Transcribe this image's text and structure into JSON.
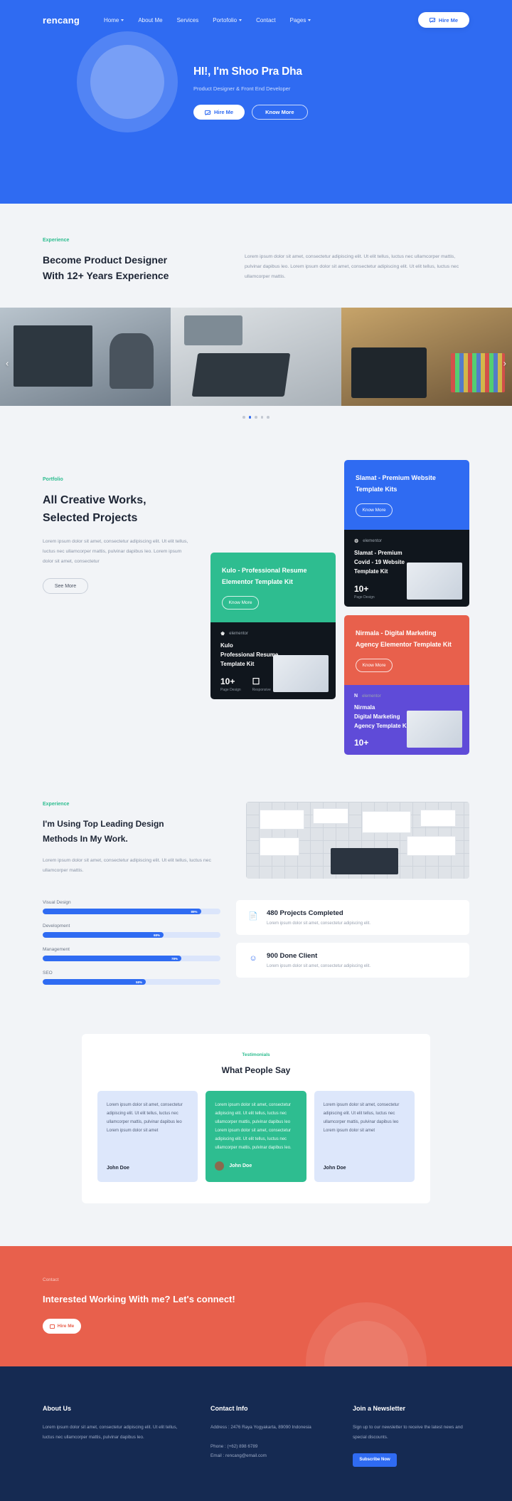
{
  "nav": {
    "logo": "rencang",
    "links": [
      {
        "label": "Home",
        "caret": true
      },
      {
        "label": "About Me",
        "caret": false
      },
      {
        "label": "Services",
        "caret": false
      },
      {
        "label": "Portofolio",
        "caret": true
      },
      {
        "label": "Contact",
        "caret": false
      },
      {
        "label": "Pages",
        "caret": true
      }
    ],
    "cta": "Hire Me"
  },
  "hero": {
    "title": "HI!, I'm Shoo Pra Dha",
    "subtitle": "Product Designer & Front End Developer",
    "btn_primary": "Hire Me",
    "btn_secondary": "Know More"
  },
  "experience": {
    "eyebrow": "Experience",
    "heading_line1": "Become Product Designer",
    "heading_line2": "With 12+ Years Experience",
    "paragraph": "Lorem ipsum dolor sit amet, consectetur adipiscing elit. Ut elit tellus, luctus nec ullamcorper mattis, pulvinar dapibus leo. Lorem ipsum dolor sit amet, consectetur adipiscing elit. Ut elit tellus, luctus nec ullamcorper mattis."
  },
  "slider": {
    "prev": "‹",
    "next": "›",
    "dots": 5,
    "active_dot": 1
  },
  "portfolio": {
    "eyebrow": "Portfolio",
    "heading_line1": "All Creative Works,",
    "heading_line2": "Selected Projects",
    "paragraph": "Lorem ipsum dolor sit amet, consectetur adipiscing elit. Ut elit tellus, luctus nec ullamcorper mattis, pulvinar dapibus leo. Lorem ipsum dolor sit amet, consectetur",
    "see_more": "See More",
    "cards": [
      {
        "title_line1": "Slamat - Premium Website",
        "title_line2": "Template Kits",
        "button": "Know More",
        "color": "#2f6bf2",
        "shot_title_line1": "Slamat - Premium",
        "shot_title_line2": "Covid - 19 Website",
        "shot_title_line3": "Template Kit",
        "shot_brand": "elementor",
        "stat1_num": "10+",
        "stat1_cap": "Page Design",
        "stat2_num": "",
        "stat2_cap": ""
      },
      {
        "title_line1": "Kulo - Professional Resume",
        "title_line2": "Elementor Template Kit",
        "button": "Know More",
        "color": "#2ebd90",
        "shot_title_line1": "Kulo",
        "shot_title_line2": "Professional Resume",
        "shot_title_line3": "Template Kit",
        "shot_brand": "elementor",
        "stat1_num": "10+",
        "stat1_cap": "Page Design",
        "stat2_num": "",
        "stat2_cap": "Responsive"
      },
      {
        "title_line1": "Nirmala - Digital Marketing",
        "title_line2": "Agency Elementor Template Kit",
        "button": "Know More",
        "color": "#e8604c",
        "shot_title_line1": "Nirmala",
        "shot_title_line2": "Digital Marketing",
        "shot_title_line3": "Agency Template Kit",
        "shot_brand": "elementor",
        "stat1_num": "10+",
        "stat1_cap": "",
        "stat2_num": "",
        "stat2_cap": ""
      }
    ]
  },
  "methods": {
    "eyebrow": "Experience",
    "heading_line1": "I'm Using Top Leading Design",
    "heading_line2": "Methods In My Work.",
    "paragraph": "Lorem ipsum dolor sit amet, consectetur adipiscing elit. Ut elit tellus, luctus nec ullamcorper mattis."
  },
  "skills": [
    {
      "label": "Visual Design",
      "pct": "89%",
      "value": 89
    },
    {
      "label": "Development",
      "pct": "68%",
      "value": 68
    },
    {
      "label": "Management",
      "pct": "78%",
      "value": 78
    },
    {
      "label": "SEO",
      "pct": "58%",
      "value": 58
    }
  ],
  "stats": [
    {
      "icon": "document-icon",
      "number": "480 Projects Completed",
      "desc": "Lorem ipsum dolor sit amet, consectetur adipiscing elit.",
      "glyph": "📄"
    },
    {
      "icon": "smiley-icon",
      "number": "900 Done Client",
      "desc": "Lorem ipsum dolor sit amet, consectetur adipiscing elit.",
      "glyph": "☺"
    }
  ],
  "testimonials": {
    "eyebrow": "Testimonials",
    "heading": "What People Say",
    "items": [
      {
        "quote": "Lorem ipsum dolor sit amet, consectetur adipiscing elit. Ut elit tellus, luctus nec ullamcorper mattis, pulvinar dapibus leo Lorem ipsum dolor sit amet",
        "name": "John Doe",
        "has_avatar": false,
        "variant": "light"
      },
      {
        "quote": "Lorem ipsum dolor sit amet, consectetur adipiscing elit. Ut elit tellus, luctus nec ullamcorper mattis, pulvinar dapibus leo Lorem ipsum dolor sit amet, consectetur adipiscing elit. Ut elit tellus, luctus nec ullamcorper mattis, pulvinar dapibus leo.",
        "name": "John Doe",
        "has_avatar": true,
        "variant": "mid"
      },
      {
        "quote": "Lorem ipsum dolor sit amet, consectetur adipiscing elit. Ut elit tellus, luctus nec ullamcorper mattis, pulvinar dapibus leo Lorem ipsum dolor sit amet",
        "name": "John Doe",
        "has_avatar": false,
        "variant": "light"
      }
    ]
  },
  "cta": {
    "eyebrow": "Contact",
    "heading": "Interested Working With me? Let's connect!",
    "button": "Hire Me"
  },
  "footer": {
    "about": {
      "heading": "About Us",
      "text": "Lorem ipsum dolor sit amet, consectetur adipiscing elit. Ut elit tellus, luctus nec ullamcorper mattis, pulvinar dapibus leo."
    },
    "contact": {
      "heading": "Contact Info",
      "address": "Address : 2476 Raya Yogyakarta, 89090 Indonesia",
      "phone": "Phone : (+62) 898 6789",
      "email": "Email : rencang@email.com"
    },
    "newsletter": {
      "heading": "Join a Newsletter",
      "text": "Sign up to our newsletter to receive the latest news and special discounts.",
      "button": "Subscribe Now"
    }
  },
  "colors": {
    "brand_blue": "#2f6bf2",
    "accent_green": "#2ebd90",
    "accent_red": "#e8604c",
    "footer_navy": "#152a52"
  }
}
